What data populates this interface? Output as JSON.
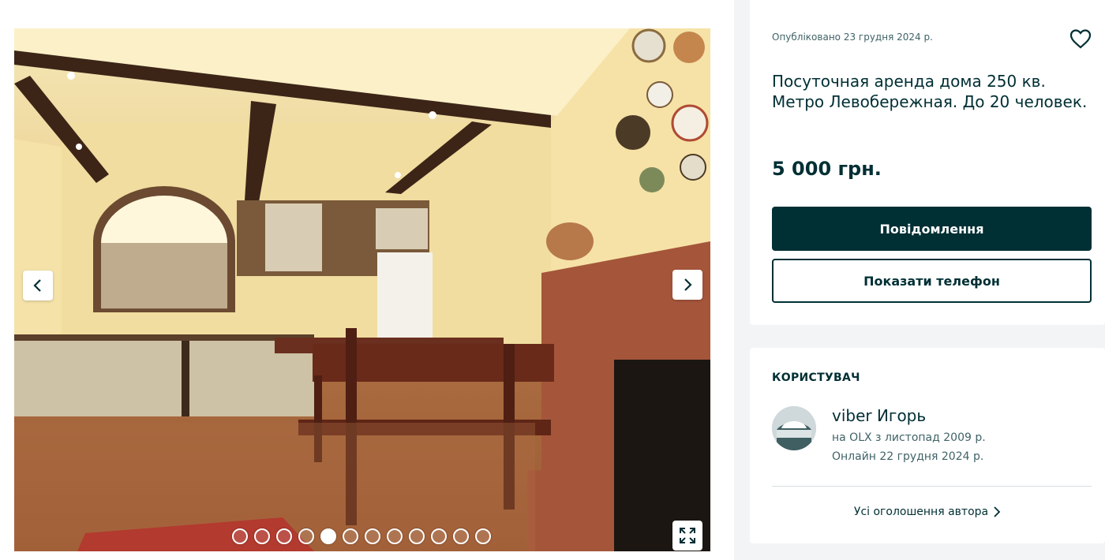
{
  "gallery": {
    "photo_alt": "Фото оголошення",
    "dots_count": 12,
    "active_dot": 5
  },
  "ad": {
    "posted": "Опубліковано 23 грудня 2024 р.",
    "title": "Посуточная аренда дома 250 кв. Метро Левобережная. До 20 человек.",
    "price": "5 000 грн.",
    "message_button": "Повідомлення",
    "phone_button": "Показати телефон"
  },
  "user": {
    "heading": "КОРИСТУВАЧ",
    "name": "viber Игорь",
    "since": "на OLX з листопад 2009 р.",
    "online": "Онлайн 22 грудня 2024 р.",
    "all_ads_link": "Усі оголошення автора"
  },
  "icons": {
    "prev": "chevron-left-icon",
    "next": "chevron-right-icon",
    "fullscreen": "expand-icon",
    "favorite": "heart-icon",
    "link_arrow": "chevron-right-icon"
  },
  "colors": {
    "brand_dark": "#002f34",
    "muted_text": "#406367",
    "page_bg": "#f2f4f5"
  }
}
